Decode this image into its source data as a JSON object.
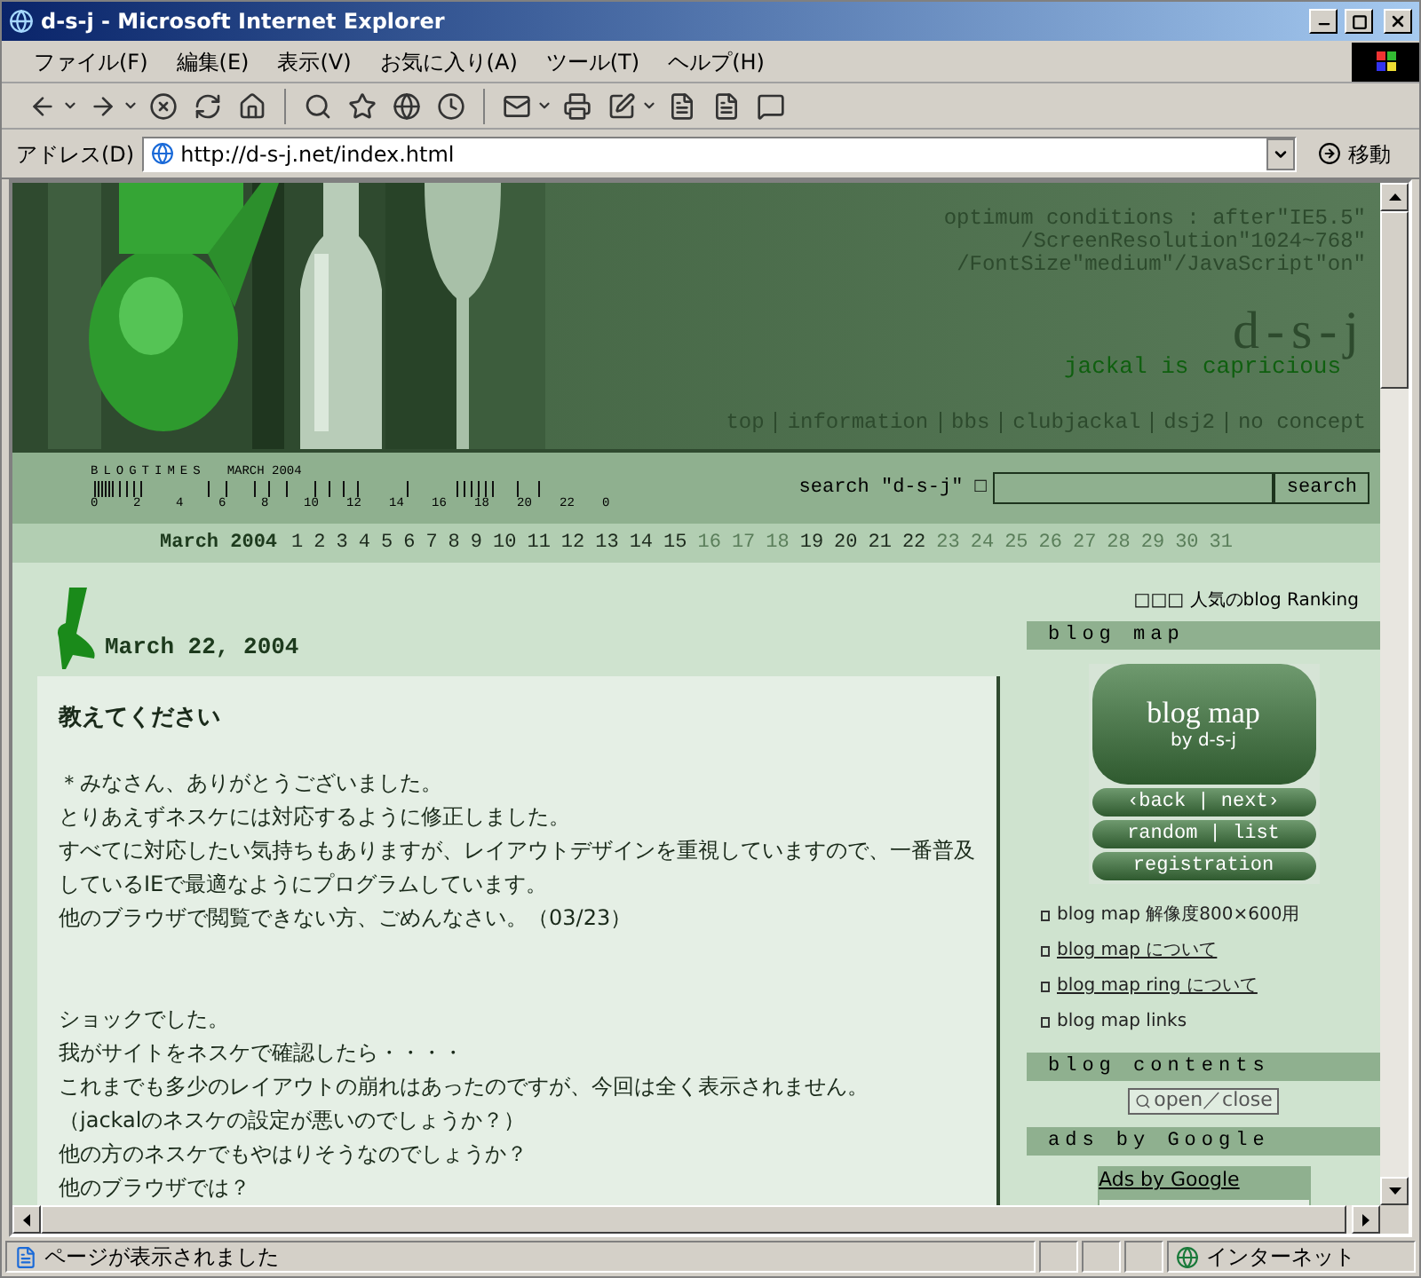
{
  "window": {
    "title": "d-s-j - Microsoft Internet Explorer"
  },
  "menu": [
    "ファイル(F)",
    "編集(E)",
    "表示(V)",
    "お気に入り(A)",
    "ツール(T)",
    "ヘルプ(H)"
  ],
  "address": {
    "label": "アドレス(D)",
    "url": "http://d-s-j.net/index.html",
    "go": "移動"
  },
  "header": {
    "conditions": [
      "optimum conditions : after\"IE5.5\"",
      "/ScreenResolution\"1024~768\"",
      "/FontSize\"medium\"/JavaScript\"on\""
    ],
    "logo": "d-s-j",
    "tagline": "jackal is capricious",
    "nav": [
      "top",
      "information",
      "bbs",
      "clubjackal",
      "dsj2",
      "no concept"
    ]
  },
  "blogtimes": {
    "title": "BLOGTIMES",
    "month": "MARCH 2004",
    "ticks": [
      "0",
      "2",
      "4",
      "6",
      "8",
      "10",
      "12",
      "14",
      "16",
      "18",
      "20",
      "22",
      "0"
    ]
  },
  "search": {
    "label": "search \"d-s-j\" □",
    "button": "search"
  },
  "calendar": {
    "month": "March 2004",
    "days": [
      {
        "label": "1",
        "posted": true
      },
      {
        "label": "2",
        "posted": true
      },
      {
        "label": "3",
        "posted": true
      },
      {
        "label": "4",
        "posted": true
      },
      {
        "label": "5",
        "posted": true
      },
      {
        "label": "6",
        "posted": true
      },
      {
        "label": "7",
        "posted": true
      },
      {
        "label": "8",
        "posted": true
      },
      {
        "label": "9",
        "posted": true
      },
      {
        "label": "10",
        "posted": true
      },
      {
        "label": "11",
        "posted": true
      },
      {
        "label": "12",
        "posted": true
      },
      {
        "label": "13",
        "posted": true
      },
      {
        "label": "14",
        "posted": true
      },
      {
        "label": "15",
        "posted": true
      },
      {
        "label": "16",
        "posted": false
      },
      {
        "label": "17",
        "posted": false
      },
      {
        "label": "18",
        "posted": false
      },
      {
        "label": "19",
        "posted": true
      },
      {
        "label": "20",
        "posted": true
      },
      {
        "label": "21",
        "posted": true
      },
      {
        "label": "22",
        "posted": true
      },
      {
        "label": "23",
        "posted": false
      },
      {
        "label": "24",
        "posted": false
      },
      {
        "label": "25",
        "posted": false
      },
      {
        "label": "26",
        "posted": false
      },
      {
        "label": "27",
        "posted": false
      },
      {
        "label": "28",
        "posted": false
      },
      {
        "label": "29",
        "posted": false
      },
      {
        "label": "30",
        "posted": false
      },
      {
        "label": "31",
        "posted": false
      }
    ]
  },
  "entry": {
    "date": "March 22, 2004",
    "title": "教えてください",
    "paragraphs": [
      [
        "＊みなさん、ありがとうございました。",
        "とりあえずネスケには対応するように修正しました。",
        "すべてに対応したい気持ちもありますが、レイアウトデザインを重視していますので、一番普及しているIEで最適なようにプログラムしています。",
        "他のブラウザで閲覧できない方、ごめんなさい。（03/23）"
      ],
      [
        "ショックでした。",
        "我がサイトをネスケで確認したら・・・・",
        "これまでも多少のレイアウトの崩れはあったのですが、今回は全く表示されません。",
        "（jackalのネスケの設定が悪いのでしょうか？）",
        "他の方のネスケでもやはりそうなのでしょうか？",
        "他のブラウザでは？"
      ]
    ]
  },
  "sidebar": {
    "ranking": "□□□ 人気のblog Ranking",
    "blog_map": {
      "heading": "blog map",
      "banner": {
        "title": "blog map",
        "byline": "by d-s-j",
        "buttons": [
          "‹back | next›",
          "random | list",
          "registration"
        ]
      },
      "links": [
        {
          "text": "blog map 解像度800×600用",
          "underlined": false
        },
        {
          "text": "blog map について",
          "underlined": true
        },
        {
          "text": "blog map ring について",
          "underlined": true
        },
        {
          "text": "blog map links",
          "underlined": false
        }
      ]
    },
    "blog_contents": {
      "heading": "blog contents",
      "button": "open／close"
    },
    "ads": {
      "heading": "ads by Google",
      "label": "Ads by Google"
    }
  },
  "status": {
    "message": "ページが表示されました",
    "zone": "インターネット"
  }
}
